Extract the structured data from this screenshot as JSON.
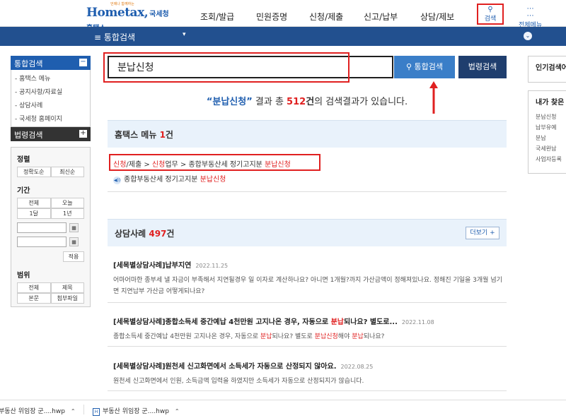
{
  "header": {
    "logo_main": "Hometax,",
    "logo_sub": "국세청홈택스",
    "logo_tag": "언제나 함께하는",
    "nav": [
      "조회/발급",
      "민원증명",
      "신청/제출",
      "신고/납부",
      "상담/제보"
    ],
    "search_label": "검색",
    "allmenu_label": "전체메뉴"
  },
  "bluebar": {
    "title": "≡  통합검색",
    "caret": "▾"
  },
  "leftnav": {
    "section1": "통합검색",
    "section1_toggle": "−",
    "items": [
      "- 홈택스 메뉴",
      "- 공지사항/자료실",
      "- 상담사례",
      "- 국세청 홈페이지"
    ],
    "section2": "법령검색",
    "section2_toggle": "+",
    "filter": {
      "sort_title": "정렬",
      "sort_options": [
        "정확도순",
        "최신순"
      ],
      "period_title": "기간",
      "period_row1": [
        "전체",
        "오늘"
      ],
      "period_row2": [
        "1달",
        "1년"
      ],
      "apply": "적용",
      "scope_title": "범위",
      "scope_row1": [
        "전체",
        "제목"
      ],
      "scope_row2": [
        "본문",
        "첨부파일"
      ]
    }
  },
  "search": {
    "query": "분납신청",
    "total_button": "통합검색",
    "law_button": "법령검색"
  },
  "summary": {
    "keyword": "“분납신청”",
    "pre": " 결과 총 ",
    "count": "512",
    "unit": "건",
    "post": "의 검색결과가 있습니다."
  },
  "menu_section": {
    "title": "홈택스 메뉴 ",
    "count": "1",
    "unit": "건",
    "path_parts": [
      {
        "t": "신청",
        "h": true
      },
      {
        "t": "/제출 > ",
        "h": false
      },
      {
        "t": "신청",
        "h": true
      },
      {
        "t": "업무 > 종합부동산세 정기고지분 ",
        "h": false
      },
      {
        "t": "분납신청",
        "h": true
      }
    ],
    "sub_icon": "◀))",
    "sub_text": "종합부동산세 정기고지분 ",
    "sub_highlight": "분납신청"
  },
  "case_section": {
    "title": "상담사례 ",
    "count": "497",
    "unit": "건",
    "more": "더보기 +",
    "cases": [
      {
        "title": "[세목별상담사례]납부지연",
        "date": "2022.11.25",
        "body": "어마어마한 종부세 낼 자금이 부족해서 지연될경우 일 이자로 계산하나요? 아니면 1개월?까지 가산금액이 정해져있나요. 정해진 기일을 3개월 넘기면 지연납부 가산금 어떻게되나요?"
      },
      {
        "title_parts": [
          {
            "t": "[세목별상담사례]종합소득세 중간예납 4천만원 고지나온 경우, 자동으로 ",
            "h": false
          },
          {
            "t": "분납",
            "h": true
          },
          {
            "t": "되나요? 별도로...",
            "h": false
          }
        ],
        "date": "2022.11.08",
        "body_parts": [
          {
            "t": "종합소득세 중간예납 4천만원 고지나온 경우, 자동으로 ",
            "h": false
          },
          {
            "t": "분납",
            "h": true
          },
          {
            "t": "되나요? 별도로 ",
            "h": false
          },
          {
            "t": "분납신청",
            "h": true
          },
          {
            "t": "해야 ",
            "h": false
          },
          {
            "t": "분납",
            "h": true
          },
          {
            "t": "되나요?",
            "h": false
          }
        ]
      },
      {
        "title": "[세목별상담사례]원천세 신고화면에서 소득세가 자동으로 산정되지 않아요.",
        "date": "2022.08.25",
        "body": "원천세 신고화면에서 인원, 소득금액 입력을 하였지만 소득세가 자동으로 산정되지가 않습니다."
      }
    ]
  },
  "rightpanel": {
    "popular_title": "인기검색어",
    "mine_title": "내가 찾은",
    "mine_items": [
      "분납신청",
      "납부유예",
      "분납",
      "국세완납",
      "사업자등록"
    ]
  },
  "downloads": [
    {
      "name": "부동산 위임장 군....hwp"
    },
    {
      "name": "부동산 위임장 군....hwp"
    }
  ],
  "colors": {
    "accent": "#1f5eaf",
    "highlight": "#e02020",
    "bar": "#22508f"
  }
}
